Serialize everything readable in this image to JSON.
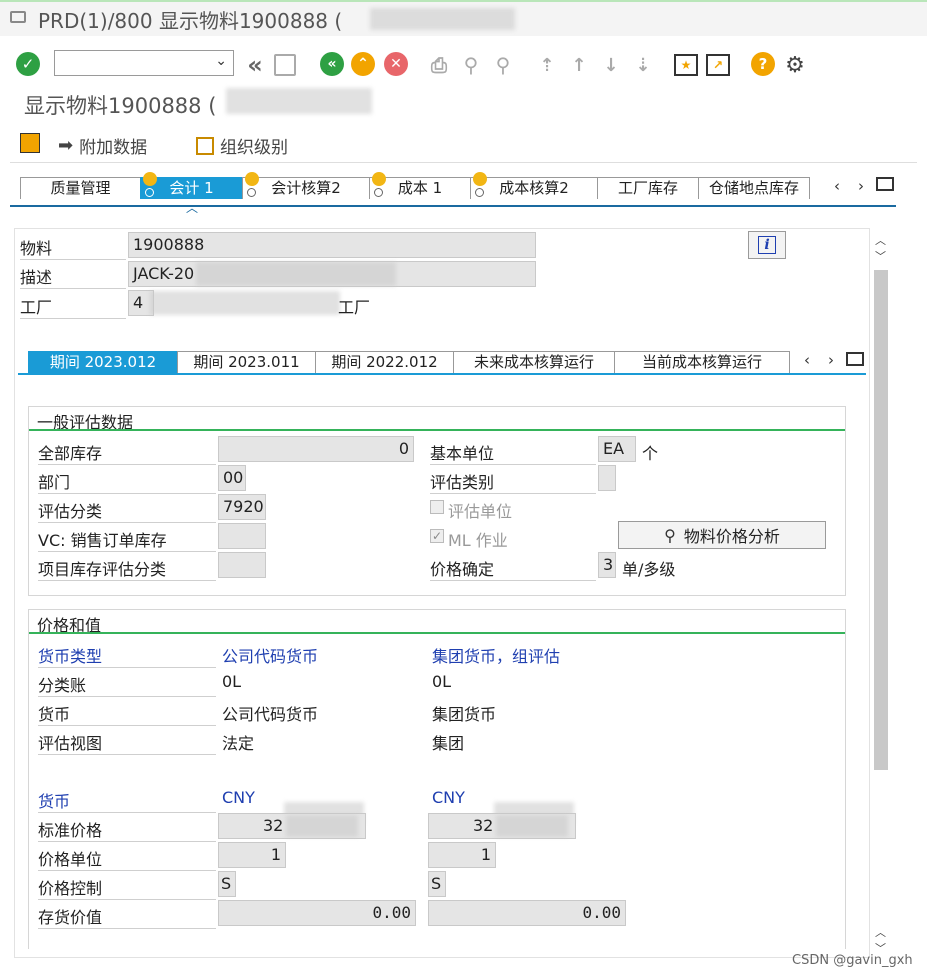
{
  "window": {
    "title": "PRD(1)/800 显示物料1900888 ("
  },
  "toolbar": {
    "command_field": "",
    "icons": [
      "enter-icon",
      "back-icon",
      "save-icon",
      "exit-icon",
      "cancel-icon",
      "print-icon",
      "find-icon",
      "find-next-icon",
      "first-page-icon",
      "prev-page-icon",
      "next-page-icon",
      "last-page-icon",
      "create-session-icon",
      "shortcut-icon",
      "help-icon",
      "settings-icon"
    ]
  },
  "screen": {
    "title": "显示物料1900888 ("
  },
  "actions": {
    "additional_data": "附加数据",
    "org_levels": "组织级别"
  },
  "tabs": [
    {
      "label": "质量管理"
    },
    {
      "label": "会计 1"
    },
    {
      "label": "会计核算2"
    },
    {
      "label": "成本 1"
    },
    {
      "label": "成本核算2"
    },
    {
      "label": "工厂库存"
    },
    {
      "label": "仓储地点库存"
    }
  ],
  "header": {
    "material_label": "物料",
    "material_value": "1900888",
    "desc_label": "描述",
    "desc_value": "JACK-20",
    "plant_label": "工厂",
    "plant_value": "4",
    "plant_suffix": "工厂"
  },
  "period_tabs": [
    {
      "label": "期间 2023.012"
    },
    {
      "label": "期间 2023.011"
    },
    {
      "label": "期间 2022.012"
    },
    {
      "label": "未来成本核算运行"
    },
    {
      "label": "当前成本核算运行"
    }
  ],
  "general": {
    "title": "一般评估数据",
    "total_stock_label": "全部库存",
    "total_stock_value": "0",
    "base_unit_label": "基本单位",
    "base_unit_value": "EA",
    "base_unit_text": "个",
    "division_label": "部门",
    "division_value": "00",
    "val_category_label": "评估类别",
    "val_category_value": "",
    "val_class_label": "评估分类",
    "val_class_value": "7920",
    "val_unit_label": "评估单位",
    "vc_label": "VC: 销售订单库存",
    "vc_value": "",
    "ml_label": "ML 作业",
    "ml_checked": "✓",
    "price_analysis_button": "物料价格分析",
    "proj_label": "项目库存评估分类",
    "proj_value": "",
    "price_det_label": "价格确定",
    "price_det_value": "3",
    "price_det_text": "单/多级"
  },
  "prices": {
    "title": "价格和值",
    "currency_type_label": "货币类型",
    "currency_type_col1": "公司代码货币",
    "currency_type_col2": "集团货币，组评估",
    "ledger_label": "分类账",
    "ledger_col1": "0L",
    "ledger_col2": "0L",
    "currency_label": "货币",
    "currency_col1": "公司代码货币",
    "currency_col2": "集团货币",
    "view_label": "评估视图",
    "view_col1": "法定",
    "view_col2": "集团",
    "curr_label": "货币",
    "curr_col1": "CNY",
    "curr_col2": "CNY",
    "std_price_label": "标准价格",
    "std_price_col1": "32",
    "std_price_col2": "32",
    "price_unit_label": "价格单位",
    "price_unit_col1": "1",
    "price_unit_col2": "1",
    "price_ctrl_label": "价格控制",
    "price_ctrl_col1": "S",
    "price_ctrl_col2": "S",
    "inv_value_label": "存货价值",
    "inv_value_col1": "0.00",
    "inv_value_col2": "0.00"
  },
  "watermark": "CSDN @gavin_gxh"
}
